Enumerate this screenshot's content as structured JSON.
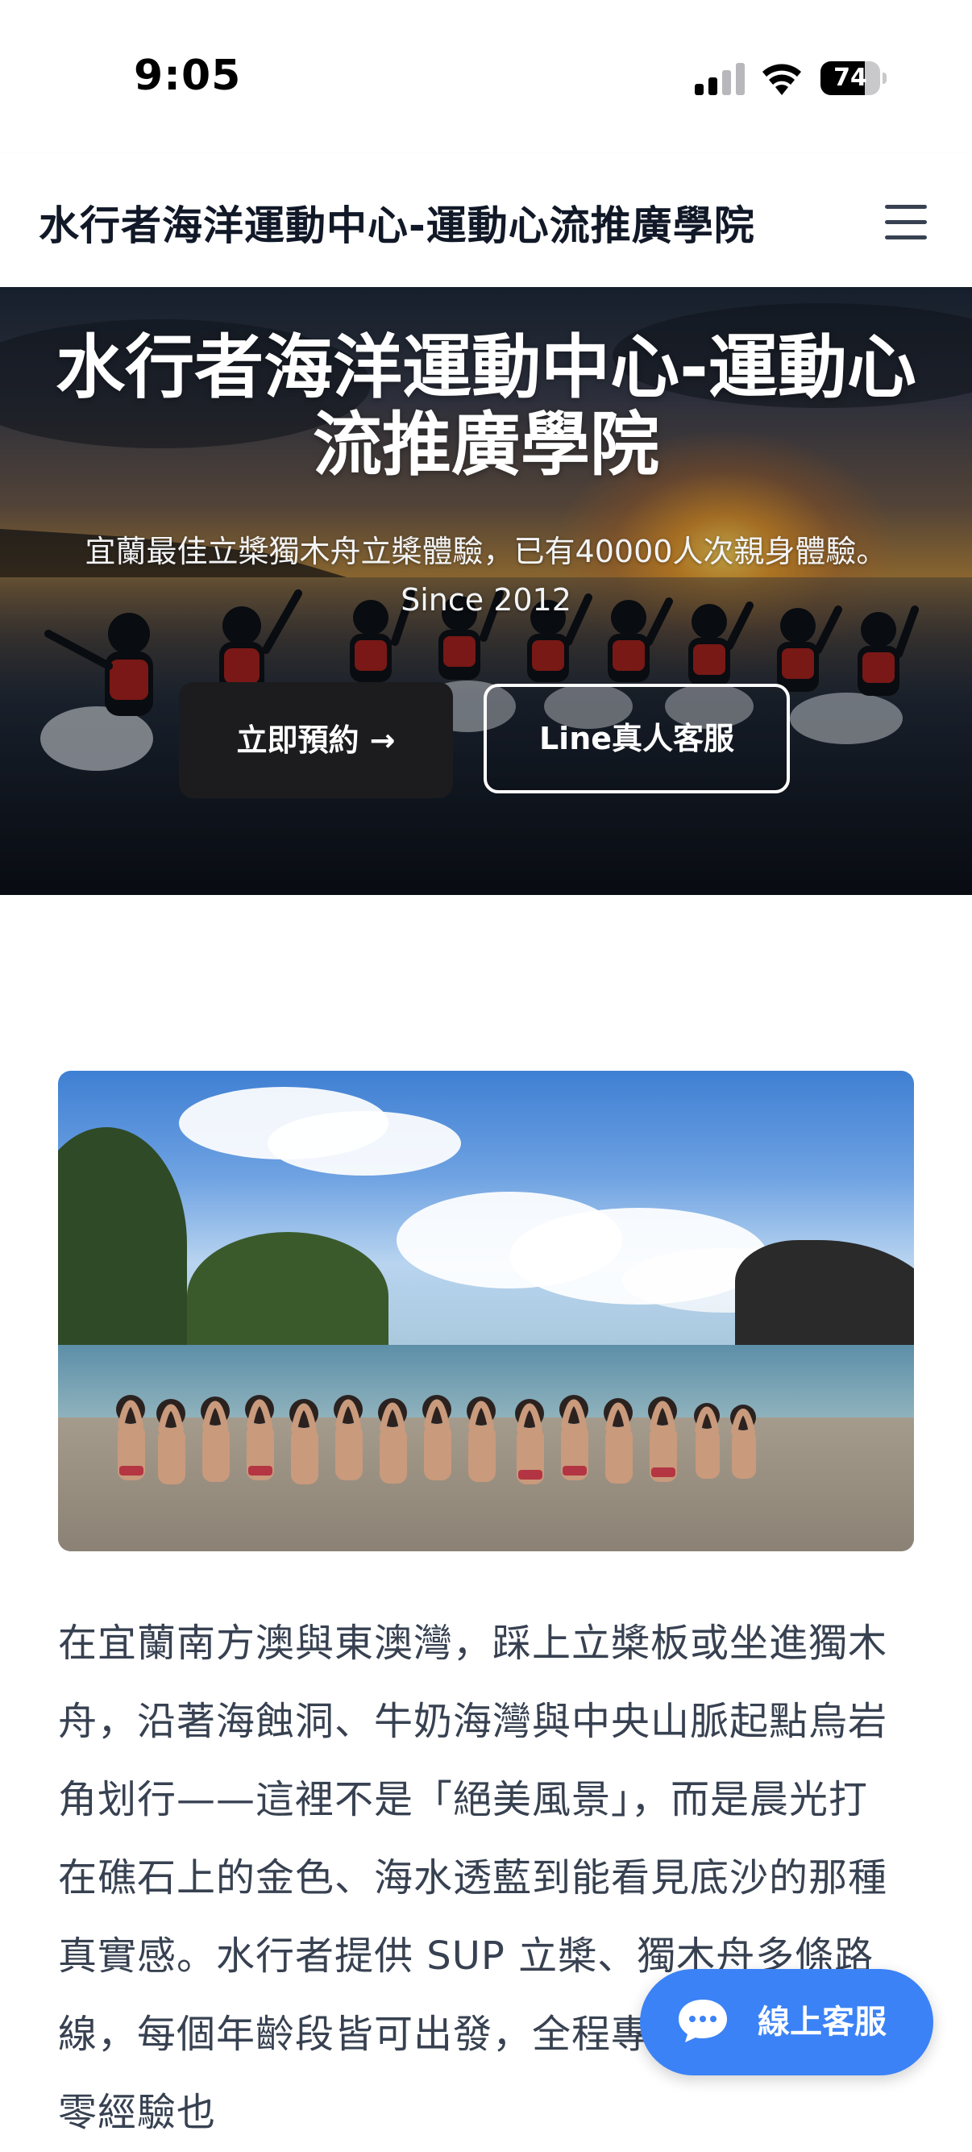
{
  "status_bar": {
    "time": "9:05",
    "battery_level": "74",
    "battery_fraction": 0.74,
    "signal_icon": "cellular-signal-icon",
    "wifi_icon": "wifi-icon"
  },
  "header": {
    "site_title": "水行者海洋運動中心-運動心流推廣學院",
    "menu_icon": "hamburger-menu-icon"
  },
  "hero": {
    "title": "水行者海洋運動中心-運動心流推廣學院",
    "subtitle": "宜蘭最佳立槳獨木舟立槳體驗，已有40000人次親身體驗。 Since 2012",
    "book_button": "立即預約 →",
    "line_button": "Line真人客服"
  },
  "content": {
    "paragraph": "在宜蘭南方澳與東澳灣，踩上立槳板或坐進獨木舟，沿著海蝕洞、牛奶海灣與中央山脈起點烏岩角划行——這裡不是「絕美風景」，而是晨光打在礁石上的金色、海水透藍到能看見底沙的那種真實感。水行者提供 SUP 立槳、獨木舟多條路線，每個年齡段皆可出發，全程專業教練陪同，零經驗也"
  },
  "chat": {
    "label": "線上客服",
    "icon": "chat-bubble-icon"
  },
  "colors": {
    "accent": "#3b82f6",
    "dark_button": "#1c1c1e",
    "text": "#374151",
    "title": "#111827"
  }
}
